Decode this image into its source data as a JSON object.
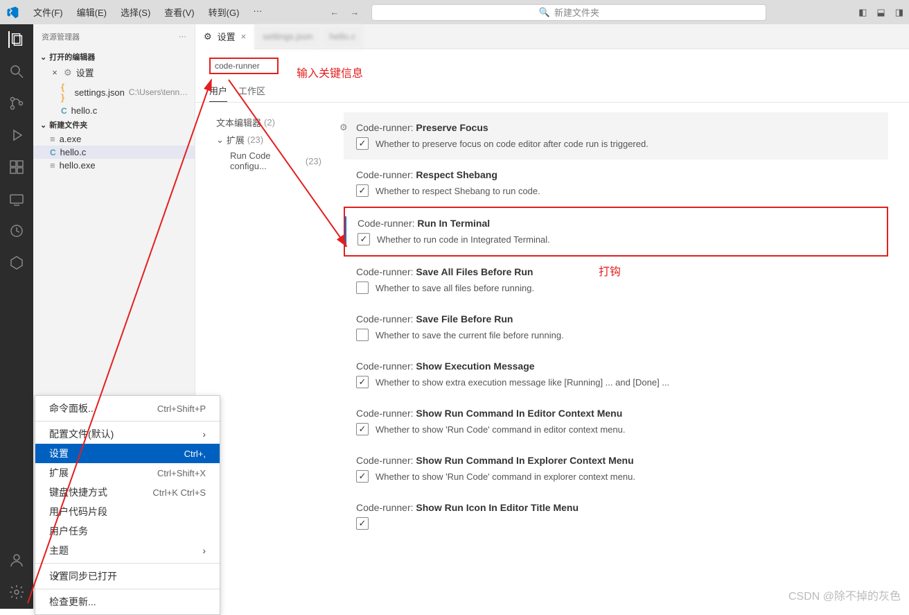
{
  "titlebar": {
    "menus": [
      "文件(F)",
      "编辑(E)",
      "选择(S)",
      "查看(V)",
      "转到(G)",
      "···"
    ],
    "search_placeholder": "新建文件夹"
  },
  "sidebar": {
    "title": "资源管理器",
    "sections": {
      "open_editors": "打开的编辑器",
      "folder": "新建文件夹"
    },
    "open_items": [
      {
        "icon": "gear",
        "label": "设置",
        "close": "×"
      },
      {
        "icon": "json",
        "label": "settings.json",
        "path": "C:\\Users\\tenny..."
      },
      {
        "icon": "c",
        "label": "hello.c"
      }
    ],
    "files": [
      {
        "icon": "file",
        "label": "a.exe"
      },
      {
        "icon": "c",
        "label": "hello.c",
        "selected": true
      },
      {
        "icon": "file",
        "label": "hello.exe"
      }
    ]
  },
  "tabs": [
    {
      "icon": "gear",
      "label": "设置",
      "active": true,
      "close": "×"
    },
    {
      "label": "settings.json",
      "blur": true
    },
    {
      "label": "hello.c",
      "blur": true
    }
  ],
  "settings": {
    "search_value": "code-runner",
    "scope_tabs": [
      "用户",
      "工作区"
    ],
    "toc": [
      {
        "label": "文本编辑器",
        "count": "(2)"
      },
      {
        "label": "扩展",
        "count": "(23)",
        "expanded": true
      },
      {
        "label": "Run Code configu...",
        "count": "(23)",
        "sub": true
      }
    ],
    "items": [
      {
        "prefix": "Code-runner:",
        "name": "Preserve Focus",
        "desc": "Whether to preserve focus on code editor after code run is triggered.",
        "checked": true,
        "highlight": true,
        "gear": true
      },
      {
        "prefix": "Code-runner:",
        "name": "Respect Shebang",
        "desc": "Whether to respect Shebang to run code.",
        "checked": true
      },
      {
        "prefix": "Code-runner:",
        "name": "Run In Terminal",
        "desc": "Whether to run code in Integrated Terminal.",
        "checked": true,
        "boxed": true,
        "bluebar": true
      },
      {
        "prefix": "Code-runner:",
        "name": "Save All Files Before Run",
        "desc": "Whether to save all files before running.",
        "checked": false
      },
      {
        "prefix": "Code-runner:",
        "name": "Save File Before Run",
        "desc": "Whether to save the current file before running.",
        "checked": false
      },
      {
        "prefix": "Code-runner:",
        "name": "Show Execution Message",
        "desc": "Whether to show extra execution message like [Running] ... and [Done] ...",
        "checked": true
      },
      {
        "prefix": "Code-runner:",
        "name": "Show Run Command In Editor Context Menu",
        "desc": "Whether to show 'Run Code' command in editor context menu.",
        "checked": true
      },
      {
        "prefix": "Code-runner:",
        "name": "Show Run Command In Explorer Context Menu",
        "desc": "Whether to show 'Run Code' command in explorer context menu.",
        "checked": true
      },
      {
        "prefix": "Code-runner:",
        "name": "Show Run Icon In Editor Title Menu",
        "desc": "",
        "checked": true
      }
    ]
  },
  "annotations": {
    "input_hint": "输入关键信息",
    "check_hint": "打钩"
  },
  "context_menu": {
    "items": [
      {
        "label": "命令面板...",
        "kb": "Ctrl+Shift+P"
      },
      {
        "sep": true
      },
      {
        "label": "配置文件(默认)",
        "chevron": true
      },
      {
        "label": "设置",
        "kb": "Ctrl+,",
        "selected": true
      },
      {
        "label": "扩展",
        "kb": "Ctrl+Shift+X"
      },
      {
        "label": "键盘快捷方式",
        "kb": "Ctrl+K Ctrl+S"
      },
      {
        "label": "用户代码片段"
      },
      {
        "label": "用户任务"
      },
      {
        "label": "主题",
        "chevron": true
      },
      {
        "sep": true
      },
      {
        "label": "设置同步已打开",
        "check": true
      },
      {
        "sep": true
      },
      {
        "label": "检查更新..."
      }
    ]
  },
  "watermark": "CSDN @除不掉的灰色"
}
